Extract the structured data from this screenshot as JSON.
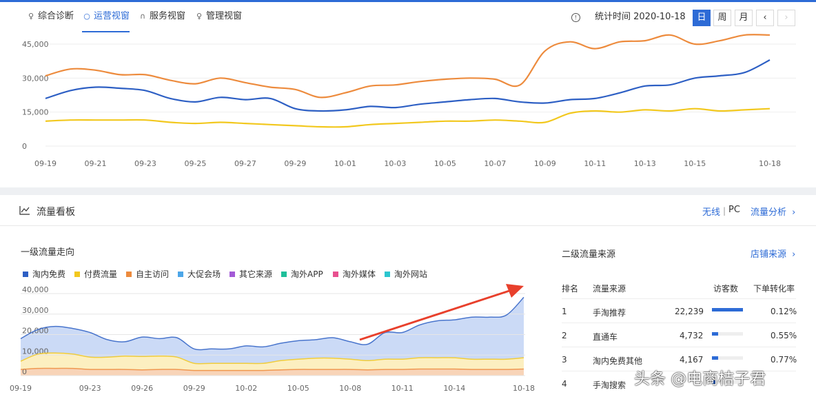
{
  "tabs": [
    {
      "label": "综合诊断",
      "icon": "bulb-icon"
    },
    {
      "label": "运营视窗",
      "icon": "ring-icon",
      "active": true
    },
    {
      "label": "服务视窗",
      "icon": "headset-icon"
    },
    {
      "label": "管理视窗",
      "icon": "bulb-icon"
    }
  ],
  "stat_time": "统计时间 2020-10-18",
  "period_buttons": [
    {
      "label": "日",
      "active": true
    },
    {
      "label": "周"
    },
    {
      "label": "月"
    }
  ],
  "panel": {
    "title": "流量看板",
    "terminal_wireless": "无线",
    "terminal_separator": "|",
    "terminal_pc": "PC",
    "analysis_link": "流量分析",
    "left_subtitle": "一级流量走向",
    "right_subtitle": "二级流量来源",
    "shop_source_link": "店铺来源"
  },
  "ranking": {
    "headers": [
      "排名",
      "流量来源",
      "访客数",
      "下单转化率"
    ],
    "rows": [
      {
        "rank": "1",
        "source": "手淘推荐",
        "visitors": "22,239",
        "share": 1.0,
        "conversion": "0.12%"
      },
      {
        "rank": "2",
        "source": "直通车",
        "visitors": "4,732",
        "share": 0.21,
        "conversion": "0.55%"
      },
      {
        "rank": "3",
        "source": "淘内免费其他",
        "visitors": "4,167",
        "share": 0.19,
        "conversion": "0.77%"
      },
      {
        "rank": "4",
        "source": "手淘搜索",
        "visitors": "",
        "share": 0.1,
        "conversion": ""
      }
    ]
  },
  "watermark": "头条 @电商桔子君",
  "arrow_color": "#e8402c",
  "chart_data": [
    {
      "type": "line",
      "title": "",
      "xlabel": "",
      "ylabel": "",
      "x": [
        "09-19",
        "09-20",
        "09-21",
        "09-22",
        "09-23",
        "09-24",
        "09-25",
        "09-26",
        "09-27",
        "09-28",
        "09-29",
        "09-30",
        "10-01",
        "10-02",
        "10-03",
        "10-04",
        "10-05",
        "10-06",
        "10-07",
        "10-08",
        "10-09",
        "10-10",
        "10-11",
        "10-12",
        "10-13",
        "10-14",
        "10-15",
        "10-16",
        "10-17",
        "10-18"
      ],
      "x_tick_labels": [
        "09-19",
        "09-21",
        "09-23",
        "09-25",
        "09-27",
        "09-29",
        "10-01",
        "10-03",
        "10-05",
        "10-07",
        "10-09",
        "10-11",
        "10-13",
        "10-15",
        "10-18"
      ],
      "y_ticks": [
        0,
        15000,
        30000,
        45000
      ],
      "y_tick_labels": [
        "0",
        "15,000",
        "30,000",
        "45,000"
      ],
      "ylim": [
        0,
        45000
      ],
      "grid": true,
      "series": [
        {
          "color": "#ed8b3d",
          "values": [
            31000,
            34000,
            33500,
            31500,
            31500,
            29000,
            27500,
            30000,
            28000,
            26000,
            25000,
            21500,
            23500,
            26500,
            27000,
            28500,
            29500,
            30000,
            29500,
            27000,
            42000,
            46000,
            43000,
            46000,
            46500,
            49000,
            45000,
            46500,
            49000,
            49000
          ]
        },
        {
          "color": "#2d5fc4",
          "values": [
            21000,
            24500,
            26000,
            25500,
            24500,
            21000,
            19500,
            21500,
            20500,
            21000,
            16500,
            15500,
            16000,
            17500,
            17000,
            18500,
            19500,
            20500,
            21000,
            19500,
            19000,
            20500,
            21000,
            23500,
            26500,
            27000,
            30000,
            31000,
            32500,
            38000
          ]
        },
        {
          "color": "#f2c81e",
          "values": [
            11000,
            11500,
            11500,
            11500,
            11500,
            10500,
            10000,
            10500,
            10000,
            9500,
            9000,
            8500,
            8500,
            9500,
            10000,
            10500,
            11000,
            11000,
            11500,
            11000,
            10500,
            14500,
            15500,
            15000,
            16000,
            15500,
            16500,
            15500,
            16000,
            16500
          ]
        }
      ]
    },
    {
      "type": "area",
      "title": "",
      "xlabel": "",
      "ylabel": "",
      "stacked": true,
      "x": [
        "09-19",
        "09-20",
        "09-21",
        "09-22",
        "09-23",
        "09-24",
        "09-25",
        "09-26",
        "09-27",
        "09-28",
        "09-29",
        "09-30",
        "10-01",
        "10-02",
        "10-03",
        "10-04",
        "10-05",
        "10-06",
        "10-07",
        "10-08",
        "10-09",
        "10-10",
        "10-11",
        "10-12",
        "10-13",
        "10-14",
        "10-15",
        "10-16",
        "10-17",
        "10-18"
      ],
      "x_tick_labels": [
        "09-19",
        "09-23",
        "09-26",
        "09-29",
        "10-02",
        "10-05",
        "10-08",
        "10-11",
        "10-14",
        "10-18"
      ],
      "y_ticks": [
        0,
        10000,
        20000,
        30000,
        40000
      ],
      "y_tick_labels": [
        "0",
        "10,000",
        "20,000",
        "30,000",
        "40,000"
      ],
      "ylim": [
        0,
        40000
      ],
      "legend_position": "top-left",
      "legend": [
        {
          "name": "淘内免费",
          "color": "#2d5fc4"
        },
        {
          "name": "付费流量",
          "color": "#f2c81e"
        },
        {
          "name": "自主访问",
          "color": "#ed8b3d"
        },
        {
          "name": "大促会场",
          "color": "#4da6e8"
        },
        {
          "name": "其它来源",
          "color": "#a35ad6"
        },
        {
          "name": "淘外APP",
          "color": "#1fbf9a"
        },
        {
          "name": "淘外媒体",
          "color": "#e8508f"
        },
        {
          "name": "淘外网站",
          "color": "#2cc6cf"
        }
      ],
      "series": [
        {
          "name": "自主访问",
          "color": "#ed8b3d",
          "fill": "#f8d4b8",
          "values": [
            3000,
            3500,
            3500,
            3500,
            3000,
            3000,
            3000,
            2800,
            3000,
            3000,
            2500,
            2500,
            2500,
            2500,
            2500,
            2800,
            3000,
            3000,
            3000,
            3000,
            2800,
            3000,
            3000,
            3200,
            3200,
            3200,
            3000,
            3000,
            3000,
            3200
          ]
        },
        {
          "name": "付费流量",
          "color": "#f2c81e",
          "fill": "#fcefc0",
          "values": [
            4000,
            7000,
            7500,
            7000,
            6000,
            6000,
            6500,
            6500,
            6500,
            6000,
            3500,
            3500,
            3500,
            3500,
            3500,
            4500,
            5000,
            5500,
            5500,
            5000,
            4500,
            5000,
            5000,
            5500,
            5500,
            5500,
            5000,
            5000,
            5000,
            5500
          ]
        },
        {
          "name": "淘内免费",
          "color": "#2d5fc4",
          "fill": "#cbdaf6",
          "values": [
            11000,
            12000,
            13000,
            12500,
            12000,
            8500,
            7000,
            9500,
            8500,
            9500,
            7000,
            7000,
            7000,
            8500,
            8000,
            8500,
            9000,
            9000,
            10000,
            8500,
            8000,
            13000,
            13000,
            16000,
            18000,
            18500,
            20500,
            20500,
            21500,
            29500
          ]
        }
      ]
    }
  ]
}
